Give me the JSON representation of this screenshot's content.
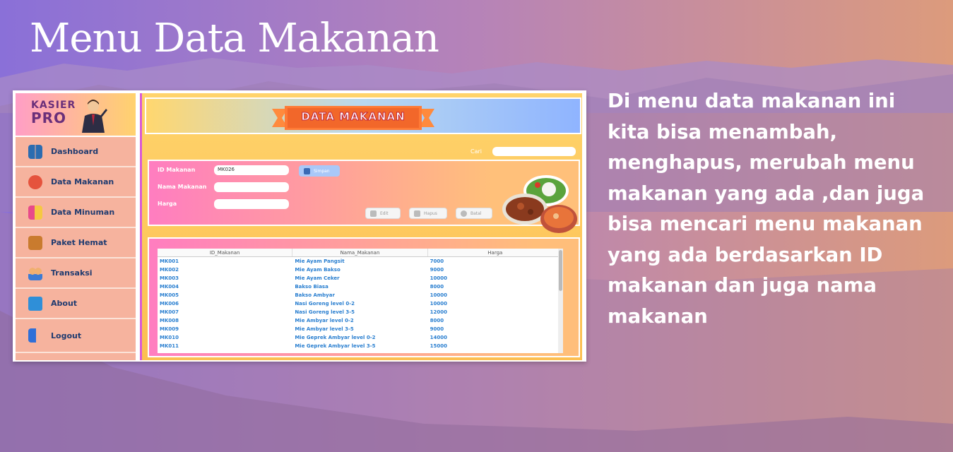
{
  "page": {
    "title": "Menu Data Makanan",
    "description": "Di menu data makanan ini kita bisa menambah, menghapus, merubah menu makanan yang ada ,dan juga bisa mencari menu makanan yang ada berdasarkan ID makanan dan juga nama makanan"
  },
  "app": {
    "logo_line1": "KASIER",
    "logo_line2": "PRO",
    "sidebar": {
      "items": [
        {
          "label": "Dashboard",
          "icon": "dashboard-icon",
          "color": "#2b6cb0"
        },
        {
          "label": "Data Makanan",
          "icon": "food-icon",
          "color": "#e5533d"
        },
        {
          "label": "Data Minuman",
          "icon": "drink-icon",
          "color": "#e84a8a"
        },
        {
          "label": "Paket Hemat",
          "icon": "package-icon",
          "color": "#c97b2e"
        },
        {
          "label": "Transaksi",
          "icon": "people-icon",
          "color": "#3b7bd4"
        },
        {
          "label": "About",
          "icon": "info-icon",
          "color": "#2f8fd8"
        },
        {
          "label": "Logout",
          "icon": "logout-icon",
          "color": "#2f6fd8"
        }
      ]
    },
    "header": {
      "banner": "DATA MAKANAN"
    },
    "search": {
      "label": "Cari",
      "value": ""
    },
    "form": {
      "id_label": "ID Makanan",
      "id_value": "MK026",
      "name_label": "Nama Makanan",
      "name_value": "",
      "price_label": "Harga",
      "price_value": "",
      "save_label": "Simpan",
      "edit_label": "Edit",
      "delete_label": "Hapus",
      "cancel_label": "Batal"
    },
    "table": {
      "columns": [
        "ID_Makanan",
        "Nama_Makanan",
        "Harga"
      ],
      "rows": [
        [
          "MK001",
          "Mie Ayam Pangsit",
          "7000"
        ],
        [
          "MK002",
          "Mie Ayam Bakso",
          "9000"
        ],
        [
          "MK003",
          "Mie Ayam Ceker",
          "10000"
        ],
        [
          "MK004",
          "Bakso Biasa",
          "8000"
        ],
        [
          "MK005",
          "Bakso Ambyar",
          "10000"
        ],
        [
          "MK006",
          "Nasi Goreng level 0-2",
          "10000"
        ],
        [
          "MK007",
          "Nasi Goreng level 3-5",
          "12000"
        ],
        [
          "MK008",
          "Mie Ambyar level 0-2",
          "8000"
        ],
        [
          "MK009",
          "Mie Ambyar level 3-5",
          "9000"
        ],
        [
          "MK010",
          "Mie Geprek Ambyar level 0-2",
          "14000"
        ],
        [
          "MK011",
          "Mie Geprek Ambyar level 3-5",
          "15000"
        ]
      ]
    }
  }
}
